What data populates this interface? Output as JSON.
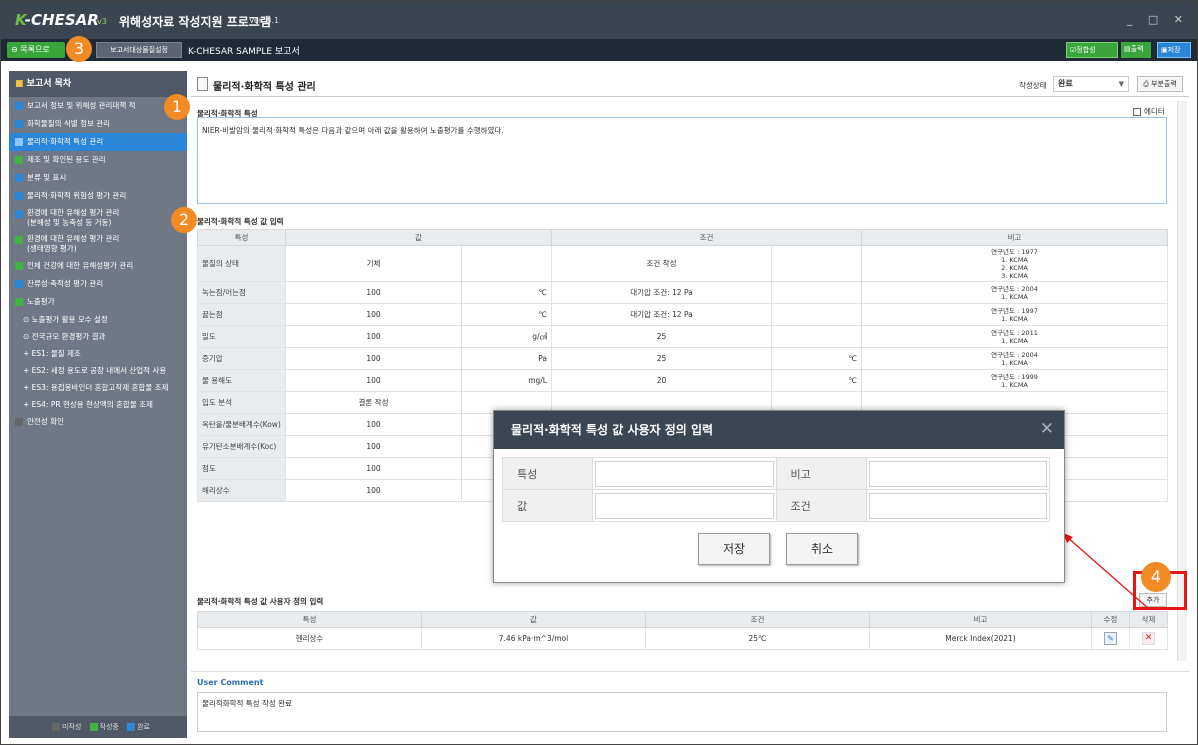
{
  "app": {
    "logo_k": "K",
    "logo_rest": "-CHESAR",
    "logo_v3": "v3",
    "title": "위해성자료 작성지원 프로그램",
    "version": "Ver. 3.1",
    "window_controls": "_ □ ✕"
  },
  "toolbar": {
    "back_label": "목록으로",
    "target_label": "보고서대상물질설정",
    "report_title": "K-CHESAR SAMPLE 보고서",
    "validate_label": "정합성",
    "print_label": "출력",
    "save_label": "저장"
  },
  "sidebar": {
    "header": "보고서 목차",
    "items": [
      {
        "label": "보고서 정보 및 위해성 관리대책 적",
        "state": "done"
      },
      {
        "label": "화학물질의 식별 정보 관리",
        "state": "done"
      },
      {
        "label": "물리적·화학적 특성 관리",
        "state": "active"
      },
      {
        "label": "제조 및 확인된 용도 관리",
        "state": "progress"
      },
      {
        "label": "분류 및 표시",
        "state": "done"
      },
      {
        "label": "물리적·화학적 위험성 평가 관리",
        "state": "done"
      },
      {
        "label": "환경에 대한 유해성 평가 관리",
        "label2": "(분해성 및 농축성 등 거동)",
        "state": "done"
      },
      {
        "label": "환경에 대한 유해성 평가 관리",
        "label2": "(생태영향 평가)",
        "state": "progress"
      },
      {
        "label": "인체 건강에 대한 유해성평가 관리",
        "state": "progress"
      },
      {
        "label": "잔류성·축적성 평가 관리",
        "state": "done"
      },
      {
        "label": "노출평가",
        "state": "progress"
      }
    ],
    "subitems": [
      "⊙ 노출평가 활용 모수 설정",
      "⊙ 전국규모 환경평가 결과",
      "+ ES1: 물질 제조",
      "+ ES2: 세정 용도로 공장 내에서 산업적 사용",
      "+ ES3: 용접봉바인더 혼합고착제 혼합물 조제",
      "+ ES4: PR 현상용 현상액의 혼합물 조제"
    ],
    "last_item": "안전성 확인",
    "legend": {
      "not_started": "미작성",
      "in_progress": "작성중",
      "done": "완료"
    }
  },
  "page": {
    "title": "물리적·화학적 특성 관리",
    "status_label": "작성상태",
    "status_value": "완료",
    "part_print": "부분출력",
    "editor_label": "에디터",
    "summary_label": "물리적·화학적 특성",
    "summary_text": "NIER-비발암의 물리적·화학적 특성은 다음과 같으며 아래 값을 활용하여 노출평가를 수행하였다.",
    "value_input_label": "물리적·화학적 특성 값 입력"
  },
  "props_table": {
    "headers": [
      "특성",
      "값",
      "조건",
      "비고"
    ],
    "rows": [
      {
        "name": "물질의 상태",
        "value": "기체",
        "unit": "",
        "cond": "조건 작성",
        "cond_unit": "",
        "note": [
          "연구년도 : 1977",
          "1. KCMA",
          "2. KCMA",
          "3. KCMA"
        ]
      },
      {
        "name": "녹는점/어는점",
        "value": "100",
        "unit": "℃",
        "cond": "대기압 조건: 12 Pa",
        "cond_unit": "",
        "note": [
          "연구년도 : 2004",
          "1. KCMA"
        ]
      },
      {
        "name": "끓는점",
        "value": "100",
        "unit": "℃",
        "cond": "대기압 조건: 12 Pa",
        "cond_unit": "",
        "note": [
          "연구년도 : 1997",
          "1. KCMA"
        ]
      },
      {
        "name": "밀도",
        "value": "100",
        "unit": "g/㎤",
        "cond": "25",
        "cond_unit": "",
        "note": [
          "연구년도 : 2011",
          "1. KCMA"
        ]
      },
      {
        "name": "증기압",
        "value": "100",
        "unit": "Pa",
        "cond": "25",
        "cond_unit": "℃",
        "note": [
          "연구년도 : 2004",
          "1. KCMA"
        ]
      },
      {
        "name": "물 용해도",
        "value": "100",
        "unit": "mg/L",
        "cond": "20",
        "cond_unit": "℃",
        "note": [
          "연구년도 : 1999",
          "1. KCMA"
        ]
      },
      {
        "name": "입도 분석",
        "value": "결론 작성",
        "unit": "",
        "cond": "",
        "cond_unit": "",
        "note": []
      },
      {
        "name": "옥탄올/물분배계수(Kow)",
        "value": "100",
        "unit": "",
        "cond": "",
        "cond_unit": "",
        "note": []
      },
      {
        "name": "유기탄소분배계수(Koc)",
        "value": "100",
        "unit": "",
        "cond": "",
        "cond_unit": "",
        "note": []
      },
      {
        "name": "점도",
        "value": "100",
        "unit": "",
        "cond": "",
        "cond_unit": "",
        "note": []
      },
      {
        "name": "해리상수",
        "value": "100",
        "unit": "",
        "cond": "",
        "cond_unit": "",
        "note": []
      }
    ]
  },
  "custom": {
    "label": "물리적·화학적 특성 값 사용자 정의 입력",
    "add_label": "추가",
    "headers": [
      "특성",
      "값",
      "조건",
      "비고",
      "수정",
      "삭제"
    ],
    "row": {
      "name": "헨리상수",
      "value": "7.46 kPa·m^3/mol",
      "cond": "25℃",
      "note": "Merck Index(2021)"
    }
  },
  "comment": {
    "title": "User Comment",
    "text": "물리적화학적 특성 작성 완료"
  },
  "modal": {
    "title": "물리적·화학적 특성 값 사용자 정의 입력",
    "close": "✕",
    "field_prop": "특성",
    "field_note": "비고",
    "field_value": "값",
    "field_cond": "조건",
    "save": "저장",
    "cancel": "취소"
  },
  "badges": {
    "b1": "1",
    "b2": "2",
    "b3": "3",
    "b4": "4"
  },
  "colors": {
    "done": "#2a86d8",
    "progress": "#3fb53f",
    "not_started": "#666666",
    "highlight": "#e51616",
    "badge": "#f28a25"
  }
}
